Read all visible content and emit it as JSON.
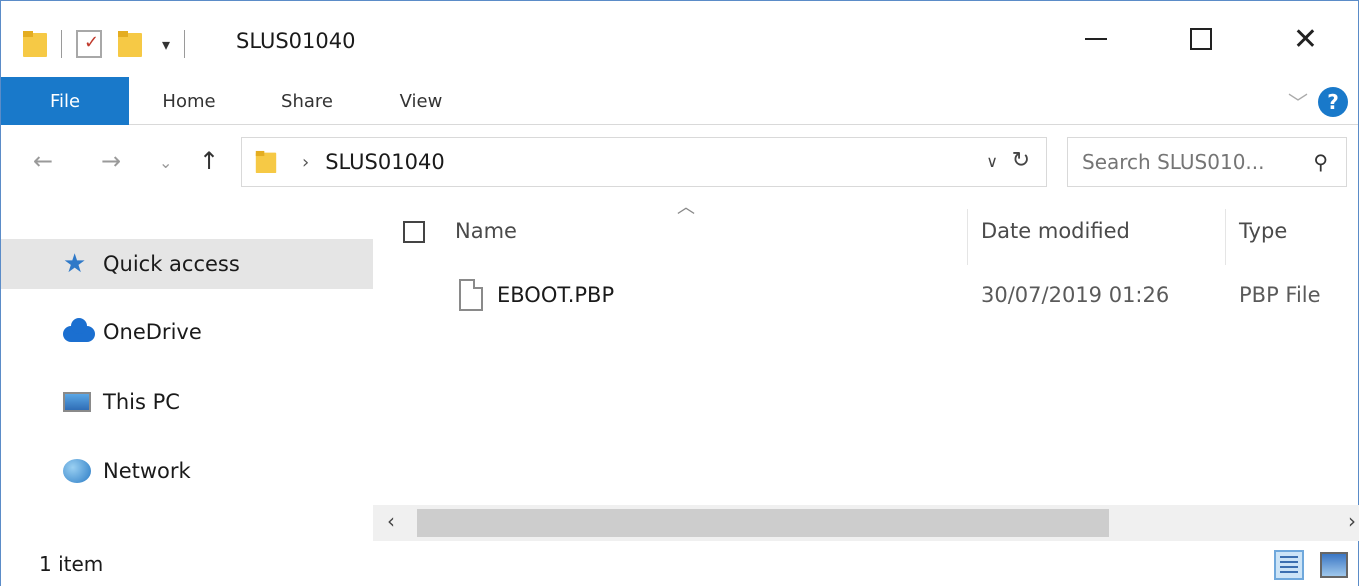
{
  "window": {
    "title": "SLUS01040",
    "minimize_icon": "minimize-icon",
    "maximize_icon": "maximize-icon",
    "close_icon": "close-icon"
  },
  "ribbon": {
    "tabs": [
      {
        "label": "File",
        "active": true
      },
      {
        "label": "Home"
      },
      {
        "label": "Share"
      },
      {
        "label": "View"
      }
    ],
    "accent": "#1979ca"
  },
  "navigation": {
    "breadcrumb": [
      "SLUS01040"
    ],
    "search_placeholder": "Search SLUS010..."
  },
  "sidebar": {
    "items": [
      {
        "label": "Quick access",
        "icon": "star-icon",
        "selected": true
      },
      {
        "label": "OneDrive",
        "icon": "cloud-icon"
      },
      {
        "label": "This PC",
        "icon": "computer-icon"
      },
      {
        "label": "Network",
        "icon": "network-icon"
      }
    ]
  },
  "file_list": {
    "columns": [
      "Name",
      "Date modified",
      "Type"
    ],
    "rows": [
      {
        "name": "EBOOT.PBP",
        "date": "30/07/2019 01:26",
        "type": "PBP File"
      }
    ]
  },
  "status": {
    "item_count": "1 item"
  }
}
